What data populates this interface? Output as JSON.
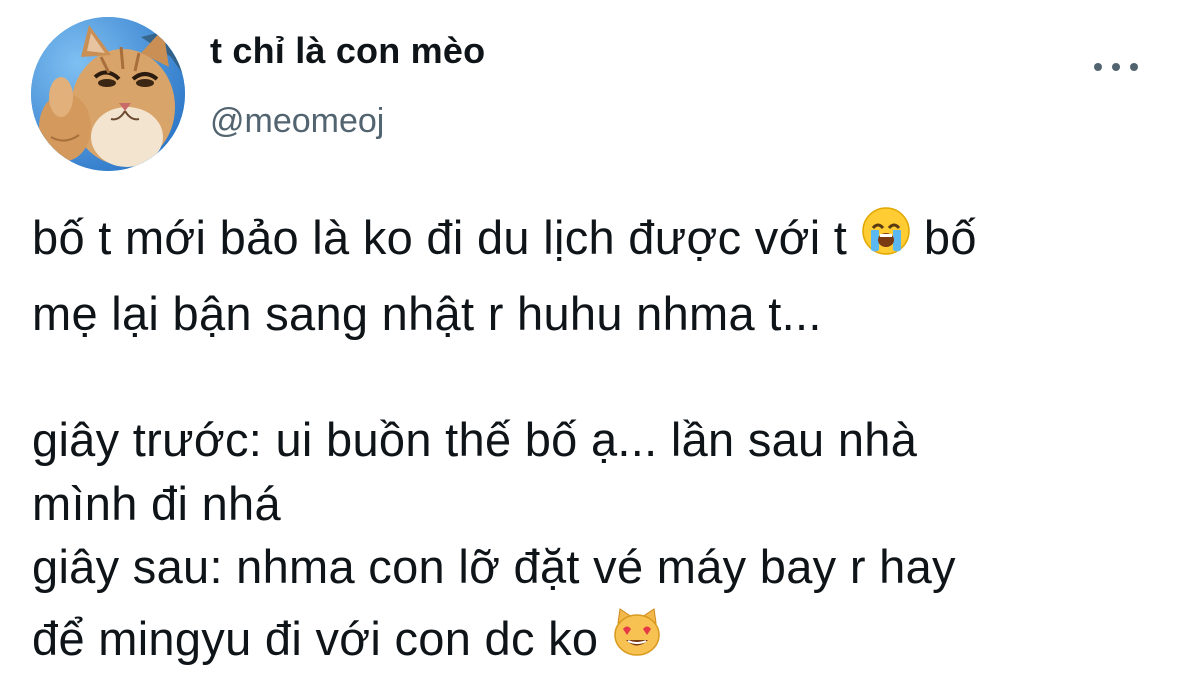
{
  "author": {
    "display_name": "t chỉ là con mèo",
    "handle": "@meomeoj"
  },
  "more_menu_icon": "more-horizontal-icon",
  "tweet_lines": [
    {
      "before": "bố t mới bảo là ko đi du lịch được với t ",
      "emoji": "loudly-crying-face-icon",
      "after": " bố"
    },
    {
      "before": "mẹ lại bận sang nhật r huhu nhma t..."
    },
    {
      "before": "giây trước: ui buồn thế bố ạ... lần sau nhà"
    },
    {
      "before": "mình đi nhá"
    },
    {
      "before": "giây sau: nhma con lỡ đặt vé máy bay r hay"
    },
    {
      "before": "để mingyu đi với con dc ko ",
      "emoji": "smiling-cat-heart-eyes-icon"
    }
  ],
  "colors": {
    "text": "#0f1419",
    "secondary": "#536471",
    "background": "#ffffff"
  }
}
